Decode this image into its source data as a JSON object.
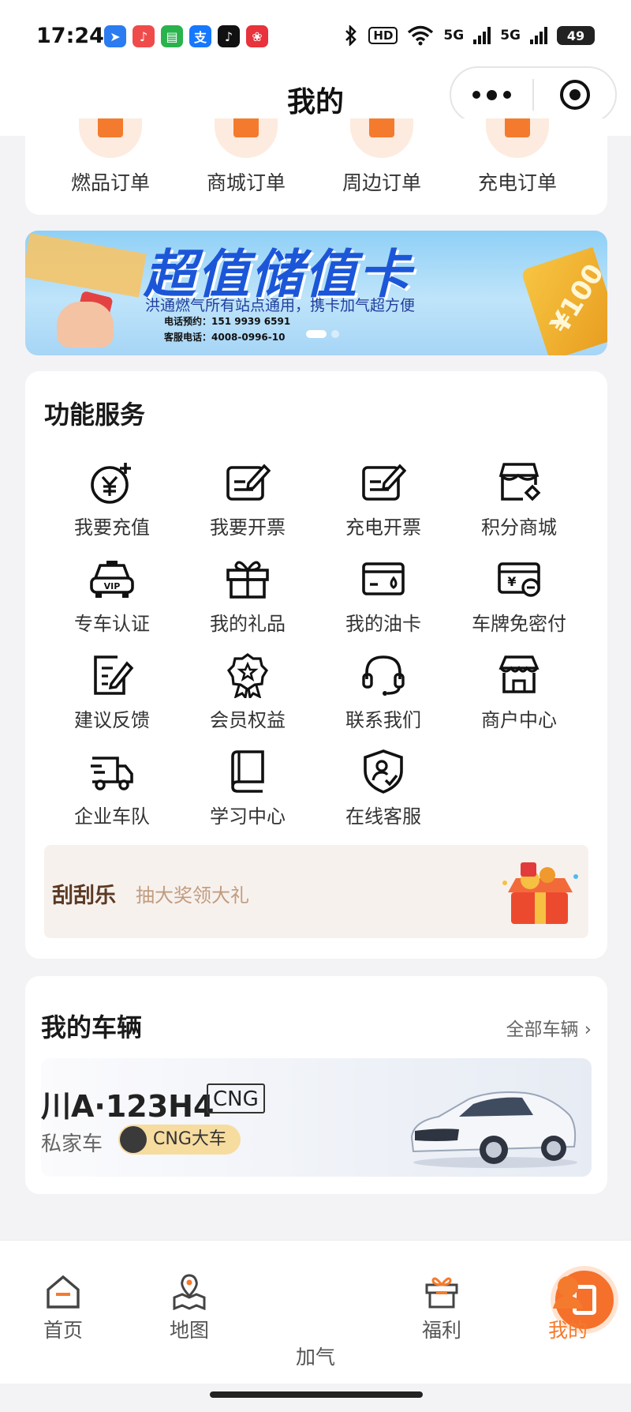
{
  "status_bar": {
    "time": "17:24",
    "apps": [
      {
        "icon": "lark-icon",
        "glyph": "➤",
        "color": "#2a7cf0"
      },
      {
        "icon": "music-icon",
        "glyph": "♪",
        "color": "#f04b4b"
      },
      {
        "icon": "messages-icon",
        "glyph": "▤",
        "color": "#29b34d"
      },
      {
        "icon": "alipay-icon",
        "glyph": "支",
        "color": "#1677ff"
      },
      {
        "icon": "tiktok-icon",
        "glyph": "♪",
        "color": "#111111"
      },
      {
        "icon": "gift-app-icon",
        "glyph": "❀",
        "color": "#e8323c"
      }
    ],
    "hd": "HD",
    "signal_1": "5G",
    "signal_2": "5G",
    "battery": "49"
  },
  "nav": {
    "title": "我的"
  },
  "orders": [
    {
      "label": "燃品订单",
      "icon": "fuel-order-icon"
    },
    {
      "label": "商城订单",
      "icon": "mall-order-icon"
    },
    {
      "label": "周边订单",
      "icon": "nearby-order-icon"
    },
    {
      "label": "充电订单",
      "icon": "charging-order-icon"
    }
  ],
  "banner": {
    "title": "超值储值卡",
    "subtitle": "洪通燃气所有站点通用，携卡加气超方便",
    "phone": "电话预约：151 9939 6591",
    "service": "客服电话：4008-0996-10",
    "coupon": "¥100"
  },
  "services": {
    "title": "功能服务",
    "items": [
      {
        "label": "我要充值",
        "icon": "recharge-icon"
      },
      {
        "label": "我要开票",
        "icon": "invoice-icon"
      },
      {
        "label": "充电开票",
        "icon": "charging-invoice-icon"
      },
      {
        "label": "积分商城",
        "icon": "points-mall-icon"
      },
      {
        "label": "专车认证",
        "icon": "vip-car-icon"
      },
      {
        "label": "我的礼品",
        "icon": "gift-icon"
      },
      {
        "label": "我的油卡",
        "icon": "fuel-card-icon"
      },
      {
        "label": "车牌免密付",
        "icon": "plate-pay-icon"
      },
      {
        "label": "建议反馈",
        "icon": "feedback-icon"
      },
      {
        "label": "会员权益",
        "icon": "member-badge-icon"
      },
      {
        "label": "联系我们",
        "icon": "headset-icon"
      },
      {
        "label": "商户中心",
        "icon": "merchant-store-icon"
      },
      {
        "label": "企业车队",
        "icon": "truck-icon"
      },
      {
        "label": "学习中心",
        "icon": "book-icon"
      },
      {
        "label": "在线客服",
        "icon": "online-service-icon"
      }
    ]
  },
  "lottery": {
    "title": "刮刮乐",
    "subtitle": "抽大奖领大礼"
  },
  "vehicles": {
    "title": "我的车辆",
    "all_label": "全部车辆",
    "plate": "川A·123H4",
    "fuel_tag": "CNG",
    "type": "私家车",
    "badge": "CNG大车"
  },
  "tabbar": [
    {
      "label": "首页",
      "icon": "home-icon"
    },
    {
      "label": "地图",
      "icon": "map-icon"
    },
    {
      "label": "加气",
      "icon": "gas-pump-icon"
    },
    {
      "label": "福利",
      "icon": "welfare-gift-icon"
    },
    {
      "label": "我的",
      "icon": "profile-icon",
      "active": true
    }
  ],
  "colors": {
    "accent": "#f47b2e",
    "banner_title": "#1c56d8",
    "badge_bg": "#f7dca0"
  }
}
